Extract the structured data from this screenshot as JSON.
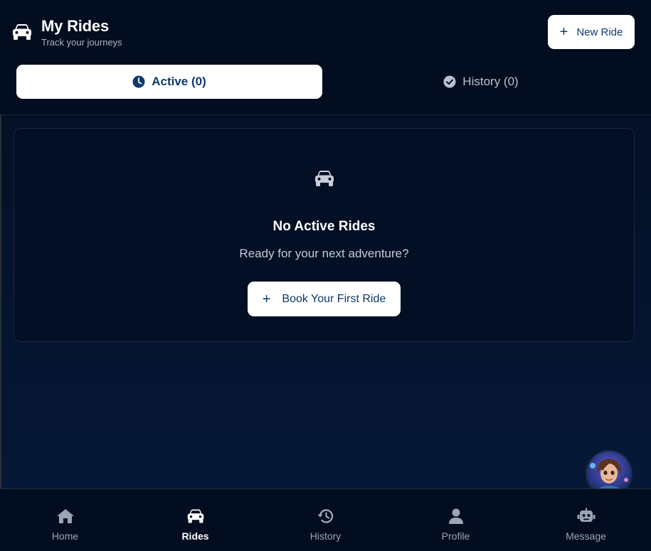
{
  "header": {
    "title": "My Rides",
    "subtitle": "Track your journeys",
    "new_ride_label": "New Ride"
  },
  "tabs": [
    {
      "label": "Active (0)",
      "icon": "clock-icon",
      "active": true
    },
    {
      "label": "History (0)",
      "icon": "check-circle-icon",
      "active": false
    }
  ],
  "empty_state": {
    "icon": "car-icon",
    "title": "No Active Rides",
    "subtitle": "Ready for your next adventure?",
    "button_label": "Book Your First Ride"
  },
  "nav": {
    "items": [
      {
        "label": "Home",
        "icon": "home-icon",
        "active": false
      },
      {
        "label": "Rides",
        "icon": "car-icon",
        "active": true
      },
      {
        "label": "History",
        "icon": "history-icon",
        "active": false
      },
      {
        "label": "Profile",
        "icon": "user-icon",
        "active": false
      },
      {
        "label": "Message",
        "icon": "robot-icon",
        "active": false
      }
    ]
  },
  "colors": {
    "background": "#020d1f",
    "accent": "#0f3a6b",
    "button_bg": "#ffffff",
    "muted_text": "#9aa6b7"
  }
}
